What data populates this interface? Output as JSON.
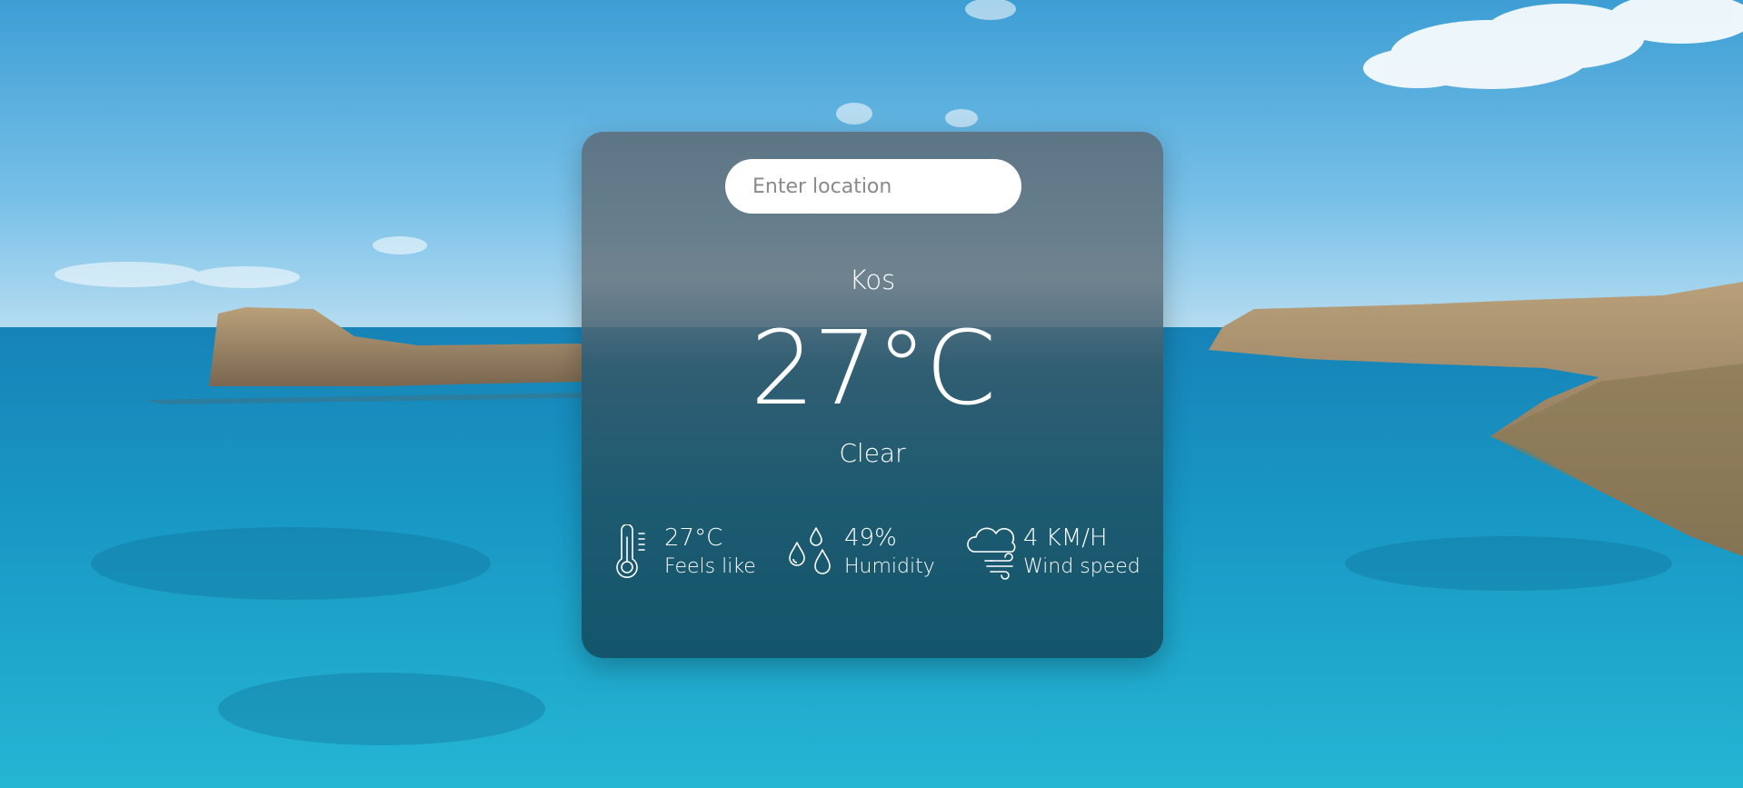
{
  "search": {
    "placeholder": "Enter location",
    "value": ""
  },
  "weather": {
    "city": "Kos",
    "temperature": "27°C",
    "description": "Clear"
  },
  "stats": {
    "feels_like": {
      "value": "27°C",
      "label": "Feels like",
      "icon": "thermometer-icon"
    },
    "humidity": {
      "value": "49%",
      "label": "Humidity",
      "icon": "water-drops-icon"
    },
    "wind": {
      "value": "4 KM/H",
      "label": "Wind speed",
      "icon": "cloud-wind-icon"
    }
  },
  "colors": {
    "card_top": "#5c707e",
    "card_bottom": "#124e62",
    "sea": "#1f93c4",
    "sky": "#3f9fd3"
  }
}
